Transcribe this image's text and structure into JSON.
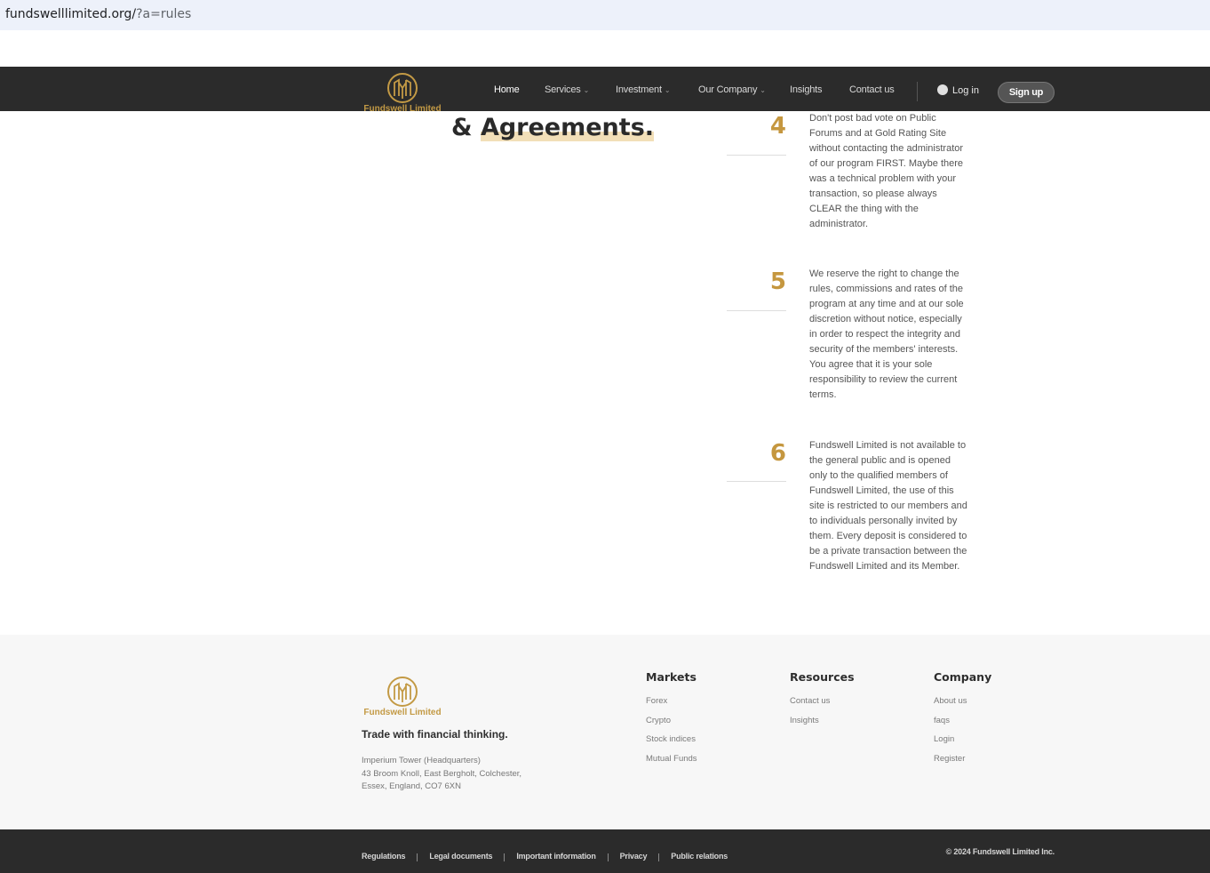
{
  "browser": {
    "url_host": "fundswelllimited.org/",
    "url_query": "?a=rules"
  },
  "brand": {
    "name": "Fundswell Limited",
    "color": "#c39a45"
  },
  "nav": {
    "items": [
      {
        "label": "Home",
        "active": true,
        "dropdown": false
      },
      {
        "label": "Services",
        "active": false,
        "dropdown": true
      },
      {
        "label": "Investment",
        "active": false,
        "dropdown": true
      },
      {
        "label": "Our Company",
        "active": false,
        "dropdown": true
      },
      {
        "label": "Insights",
        "active": false,
        "dropdown": false
      },
      {
        "label": "Contact us",
        "active": false,
        "dropdown": false
      }
    ],
    "caret": "⌄",
    "login_label": "Log in",
    "signup_label": "Sign up"
  },
  "page": {
    "heading_prefix": "& ",
    "heading_highlight": "Agreements."
  },
  "rules": [
    {
      "number": "4",
      "text": "Don't post bad vote on Public Forums and at Gold Rating Site without contacting the administrator of our program FIRST. Maybe there was a technical problem with your transaction, so please always CLEAR the thing with the administrator."
    },
    {
      "number": "5",
      "text": "We reserve the right to change the rules, commissions and rates of the program at any time and at our sole discretion without notice, especially in order to respect the integrity and security of the members' interests. You agree that it is your sole responsibility to review the current terms."
    },
    {
      "number": "6",
      "text": "Fundswell Limited is not available to the general public and is opened only to the qualified members of Fundswell Limited, the use of this site is restricted to our members and to individuals personally invited by them. Every deposit is considered to be a private transaction between the Fundswell Limited and its Member."
    }
  ],
  "footer": {
    "tagline": "Trade with financial thinking.",
    "address": [
      "Imperium Tower (Headquarters)",
      "43 Broom Knoll, East Bergholt, Colchester,",
      "Essex, England, CO7 6XN"
    ],
    "columns": [
      {
        "title": "Markets",
        "links": [
          "Forex",
          "Crypto",
          "Stock indices",
          "Mutual Funds"
        ]
      },
      {
        "title": "Resources",
        "links": [
          "Contact us",
          "Insights"
        ]
      },
      {
        "title": "Company",
        "links": [
          "About us",
          "faqs",
          "Login",
          "Register"
        ]
      }
    ],
    "bottom_links": [
      "Regulations",
      "Legal documents",
      "Important information",
      "Privacy",
      "Public relations"
    ],
    "copyright": "© 2024 Fundswell Limited Inc."
  }
}
